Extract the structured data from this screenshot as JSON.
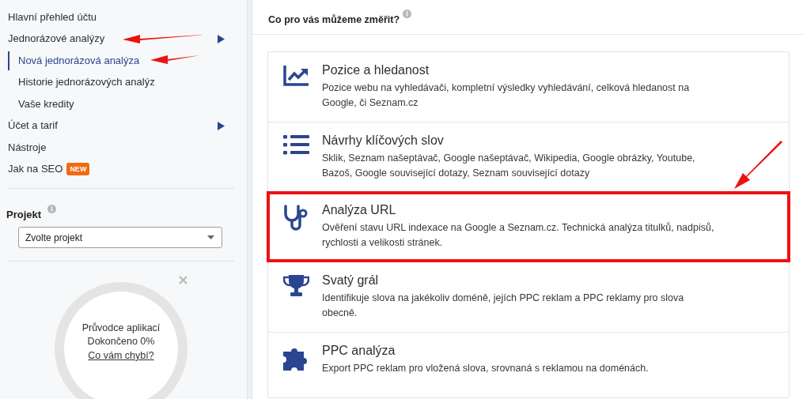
{
  "sidebar": {
    "nav": [
      {
        "label": "Hlavní přehled účtu",
        "selected": false,
        "submenu": false,
        "annotated": false
      },
      {
        "label": "Jednorázové analýzy",
        "selected": false,
        "submenu": true,
        "annotated": true,
        "children": [
          {
            "label": "Nová jednorázová analýza",
            "selected": true,
            "annotated": true
          },
          {
            "label": "Historie jednorázových analýz",
            "selected": false,
            "annotated": false
          },
          {
            "label": "Vaše kredity",
            "selected": false,
            "annotated": false
          }
        ]
      },
      {
        "label": "Účet a tarif",
        "selected": false,
        "submenu": true,
        "annotated": false
      },
      {
        "label": "Nástroje",
        "selected": false,
        "submenu": false,
        "annotated": false
      },
      {
        "label": "Jak na SEO",
        "selected": false,
        "submenu": false,
        "annotated": false,
        "badge": "NEW"
      }
    ],
    "project": {
      "label": "Projekt",
      "select": "Zvolte projekt"
    },
    "guide": {
      "lines": [
        "Průvodce aplikací",
        "Dokončeno 0%"
      ],
      "link": "Co vám chybí?"
    }
  },
  "main": {
    "title": "Co pro vás můžeme změřit?",
    "options": [
      {
        "kind": "chart",
        "title": "Pozice a hledanost",
        "description": "Pozice webu na vyhledávači, kompletní výsledky vyhledávání, celková hledanost na Google, či Seznam.cz",
        "highlighted": false
      },
      {
        "kind": "list",
        "title": "Návrhy klíčových slov",
        "description": "Sklik, Seznam našeptávač, Google našeptávač, Wikipedia, Google obrázky, Youtube, Bazoš, Google související dotazy, Seznam související dotazy",
        "highlighted": false
      },
      {
        "kind": "stethoscope",
        "title": "Analýza URL",
        "description": "Ověření stavu URL indexace na Google a Seznam.cz. Technická analýza titulků, nadpisů, rychlosti a velikosti stránek.",
        "highlighted": true
      },
      {
        "kind": "trophy",
        "title": "Svatý grál",
        "description": "Identifikuje slova na jakékoliv doméně, jejích PPC reklam a PPC reklamy pro slova obecně.",
        "highlighted": false
      },
      {
        "kind": "puzzle",
        "title": "PPC analýza",
        "description": "Export PPC reklam pro vložená slova, srovnaná s reklamou na doménách.",
        "highlighted": false
      }
    ]
  }
}
